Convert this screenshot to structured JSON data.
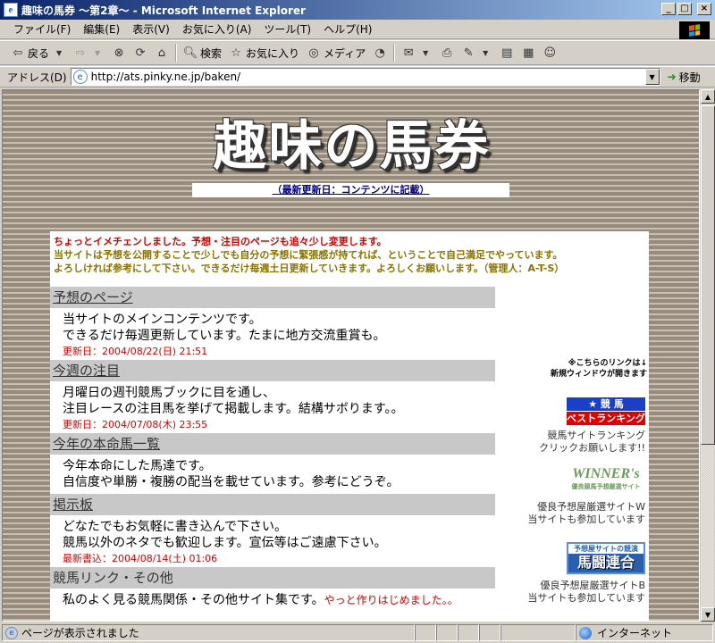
{
  "window": {
    "title": "趣味の馬券 ～第2章～ - Microsoft Internet Explorer",
    "controls": {
      "minimize": "_",
      "maximize": "□",
      "close": "×"
    }
  },
  "menu": [
    "ファイル(F)",
    "編集(E)",
    "表示(V)",
    "お気に入り(A)",
    "ツール(T)",
    "ヘルプ(H)"
  ],
  "toolbar": {
    "back": "戻る",
    "search": "検索",
    "favorites": "お気に入り",
    "media": "メディア"
  },
  "address": {
    "label": "アドレス(D)",
    "url": "http://ats.pinky.ne.jp/baken/",
    "go": "移動"
  },
  "page": {
    "site_title": "趣味の馬券",
    "update_link": "（最新更新日：コンテンツに記載）",
    "notice": {
      "line1": "ちょっとイメチェンしました。予想・注目のページも追々少し変更します。",
      "line2": "当サイトは予想を公開することで少しでも自分の予想に緊張感が持てれば、ということで自己満足でやっています。",
      "line3": "よろしければ参考にして下さい。できるだけ毎週土日更新していきます。よろしくお願いします。（管理人：A-T-S）"
    },
    "sections": [
      {
        "title": "予想のページ",
        "lines": [
          "当サイトのメインコンテンツです。",
          "できるだけ毎週更新しています。たまに地方交流重賞も。"
        ],
        "updated": "更新日：2004/08/22(日) 21:51"
      },
      {
        "title": "今週の注目",
        "lines": [
          "月曜日の週刊競馬ブックに目を通し、",
          "注目レースの注目馬を挙げて掲載します。結構サボります。。"
        ],
        "updated": "更新日：2004/07/08(木) 23:55"
      },
      {
        "title": "今年の本命馬一覧",
        "lines": [
          "今年本命にした馬達です。",
          "自信度や単勝・複勝の配当を載せています。参考にどうぞ。"
        ],
        "updated": ""
      },
      {
        "title": "掲示板",
        "lines": [
          "どなたでもお気軽に書き込んで下さい。",
          "競馬以外のネタでも歓迎します。宣伝等はご遠慮下さい。"
        ],
        "updated": "最新書込：2004/08/14(土) 01:06"
      },
      {
        "title": "競馬リンク・その他",
        "lines": [
          "私のよく見る競馬関係・その他サイト集です。"
        ],
        "extra": "やっと作りはじめました。。",
        "updated": ""
      }
    ],
    "side": {
      "note_line1": "※こちらのリンクは↓",
      "note_line2": "新規ウィンドウが開きます",
      "banner1_top": "★ 競 馬",
      "banner1_bottom": "ベストランキング",
      "banner1_text1": "競馬サイトランキング",
      "banner1_text2": "クリックお願いします!!",
      "banner2_main": "WINNER's",
      "banner2_sub": "優良競馬予想厳選サイト",
      "banner2_text1": "優良予想屋厳選サイトW",
      "banner2_text2": "当サイトも参加しています",
      "banner3_top": "予想屋サイトの競演",
      "banner3_main": "馬闘連合",
      "banner3_text1": "優良予想屋厳選サイトB",
      "banner3_text2": "当サイトも参加しています"
    }
  },
  "status": {
    "text": "ページが表示されました",
    "zone": "インターネット"
  }
}
